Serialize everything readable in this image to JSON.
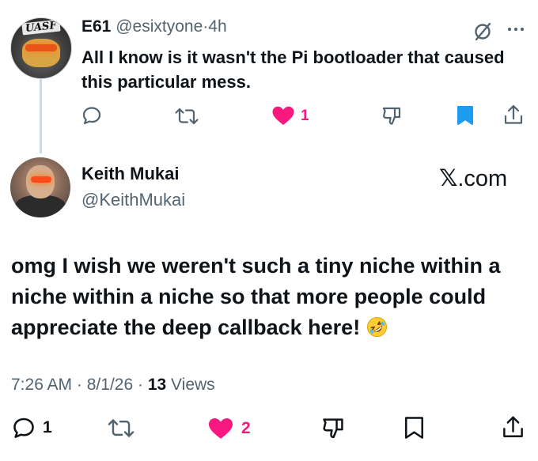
{
  "parent_tweet": {
    "author_name": "E61",
    "author_handle": "@esixtyone",
    "separator": "·",
    "time_ago": "4h",
    "text": "All I know is it wasn't the Pi bootloader that caused this particular mess.",
    "likes": "1",
    "avatar_text": "UASF",
    "icons": {
      "grok": "grok-icon",
      "more": "more-icon",
      "reply": "reply-icon",
      "repost": "repost-icon",
      "like": "heart-icon",
      "dislike": "dislike-icon",
      "bookmark": "bookmark-icon",
      "share": "share-icon"
    },
    "liked": true,
    "bookmarked": true
  },
  "main_tweet": {
    "author_name": "Keith Mukai",
    "author_handle": "@KeithMukai",
    "source_label": ".com",
    "source_x": "𝕏",
    "text": "omg I wish we weren't such a tiny niche within a niche within a niche so that more people could appreciate the deep callback here!",
    "emoji": "rolling-on-floor-laughing",
    "time": "7:26 AM",
    "date": "8/1/26",
    "dot": "·",
    "views_count": "13",
    "views_label": "Views",
    "replies": "1",
    "likes": "2",
    "liked": true,
    "bookmarked": false
  },
  "colors": {
    "like_pink": "#f91880",
    "bookmark_blue": "#1d9bf0",
    "icon_gray": "#536471",
    "text": "#0f1419",
    "thread_line": "#cfd9de"
  }
}
